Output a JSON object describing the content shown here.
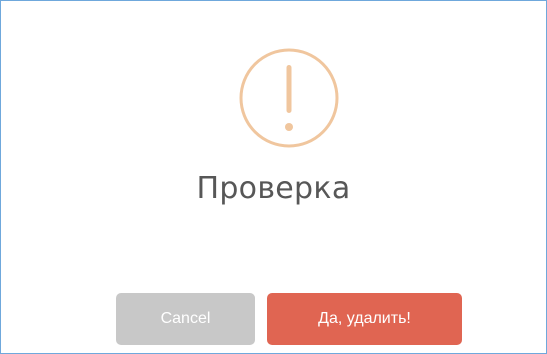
{
  "dialog": {
    "icon": "exclamation-circle-icon",
    "title": "Проверка",
    "cancel_label": "Cancel",
    "confirm_label": "Да, удалить!",
    "colors": {
      "icon": "#f0c69e",
      "cancel": "#c8c8c8",
      "confirm": "#e06552",
      "border": "#6fa8dc"
    }
  }
}
